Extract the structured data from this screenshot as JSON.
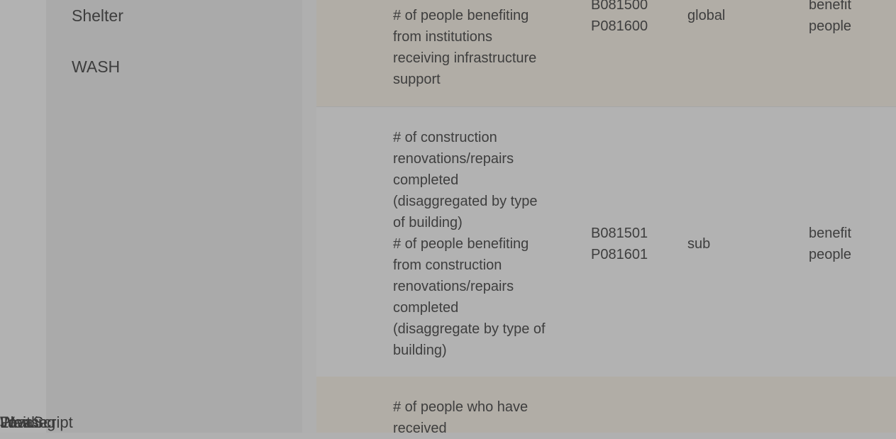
{
  "sidebar": {
    "items": [
      {
        "label": "Shelter"
      },
      {
        "label": "WASH"
      }
    ]
  },
  "table": {
    "rows": [
      {
        "description": [
          "# of people benefiting",
          "from institutions",
          "receiving infrastructure",
          "support"
        ],
        "codes": [
          "B081500",
          "P081600"
        ],
        "level": "global",
        "unit": [
          "benefit",
          "people"
        ]
      },
      {
        "description": [
          "# of construction",
          "renovations/repairs",
          "completed",
          "(disaggregated by type",
          "of building)",
          "# of people benefiting",
          "from construction",
          "renovations/repairs",
          "completed",
          "(disaggregate by type of",
          "building)"
        ],
        "codes": [
          "B081501",
          "P081601"
        ],
        "level": "sub",
        "unit": [
          "benefit",
          "people"
        ]
      },
      {
        "description": [
          "# of people who have",
          "received"
        ]
      }
    ]
  },
  "noscript_overlap": [
    "JavaScript",
    "Loading",
    "Please",
    "Wait"
  ]
}
